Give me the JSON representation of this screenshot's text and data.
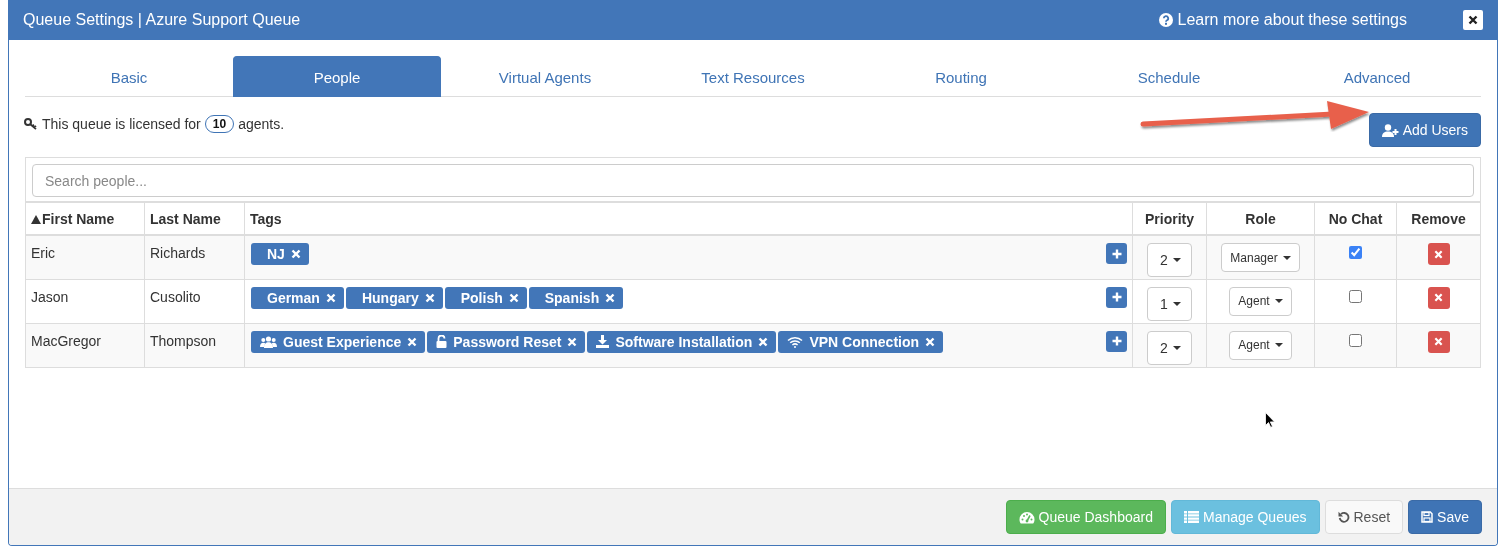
{
  "window": {
    "title": "Queue Settings | Azure Support Queue",
    "help_link": "Learn more about these settings"
  },
  "tabs": [
    {
      "label": "Basic",
      "selected": false
    },
    {
      "label": "People",
      "selected": true
    },
    {
      "label": "Virtual Agents",
      "selected": false
    },
    {
      "label": "Text Resources",
      "selected": false
    },
    {
      "label": "Routing",
      "selected": false
    },
    {
      "label": "Schedule",
      "selected": false
    },
    {
      "label": "Advanced",
      "selected": false
    }
  ],
  "license": {
    "prefix": "This queue is licensed for",
    "count": "10",
    "suffix": "agents."
  },
  "add_users_button": "Add Users",
  "search": {
    "placeholder": "Search people..."
  },
  "table": {
    "columns": [
      {
        "label": "First Name",
        "sorted": true
      },
      {
        "label": "Last Name",
        "sorted": false
      },
      {
        "label": "Tags",
        "sorted": false
      },
      {
        "label": "Priority",
        "sorted": false
      },
      {
        "label": "Role",
        "sorted": false
      },
      {
        "label": "No Chat",
        "sorted": false
      },
      {
        "label": "Remove",
        "sorted": false
      }
    ],
    "rows": [
      {
        "first_name": "Eric",
        "last_name": "Richards",
        "tags": [
          {
            "label": "NJ",
            "kind": "plain"
          }
        ],
        "priority": "2",
        "role": "Manager",
        "no_chat": true
      },
      {
        "first_name": "Jason",
        "last_name": "Cusolito",
        "tags": [
          {
            "label": "German",
            "kind": "plain"
          },
          {
            "label": "Hungary",
            "kind": "plain"
          },
          {
            "label": "Polish",
            "kind": "plain"
          },
          {
            "label": "Spanish",
            "kind": "plain"
          }
        ],
        "priority": "1",
        "role": "Agent",
        "no_chat": false
      },
      {
        "first_name": "MacGregor",
        "last_name": "Thompson",
        "tags": [
          {
            "label": "Guest Experience",
            "kind": "group"
          },
          {
            "label": "Password Reset",
            "kind": "unlock"
          },
          {
            "label": "Software Installation",
            "kind": "download"
          },
          {
            "label": "VPN Connection",
            "kind": "wifi"
          }
        ],
        "priority": "2",
        "role": "Agent",
        "no_chat": false
      }
    ]
  },
  "footer_buttons": [
    {
      "label": "Queue Dashboard",
      "kind": "dashboard"
    },
    {
      "label": "Manage Queues",
      "kind": "manage"
    },
    {
      "label": "Reset",
      "kind": "reset"
    },
    {
      "label": "Save",
      "kind": "save"
    }
  ]
}
